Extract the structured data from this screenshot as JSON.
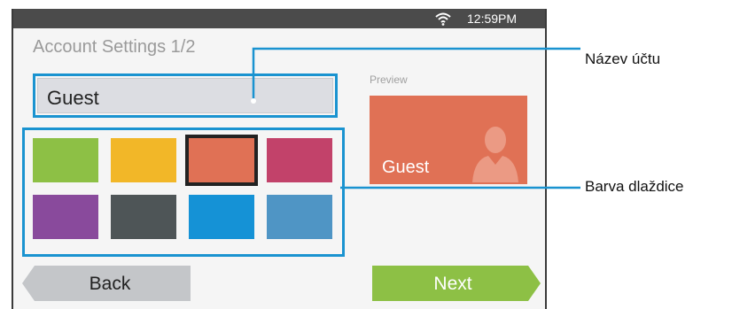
{
  "status_bar": {
    "time": "12:59PM",
    "wifi_icon": "wifi-icon"
  },
  "title": "Account Settings 1/2",
  "name_field": {
    "value": "Guest"
  },
  "preview": {
    "label": "Preview",
    "tile_name": "Guest",
    "tile_color": "#e07155",
    "avatar_icon": "person-silhouette-icon"
  },
  "palette": {
    "colors": [
      "#8dc045",
      "#f2b728",
      "#e07155",
      "#c2426a",
      "#894a9c",
      "#4e5557",
      "#1592d6",
      "#4f95c5"
    ],
    "selected_index": 2
  },
  "buttons": {
    "back": "Back",
    "next": "Next"
  },
  "callouts": {
    "account_name": "Název účtu",
    "tile_color": "Barva dlaždice"
  },
  "colors": {
    "accent": "#1a93d0",
    "next": "#8dc045",
    "back": "#c4c6c9"
  }
}
